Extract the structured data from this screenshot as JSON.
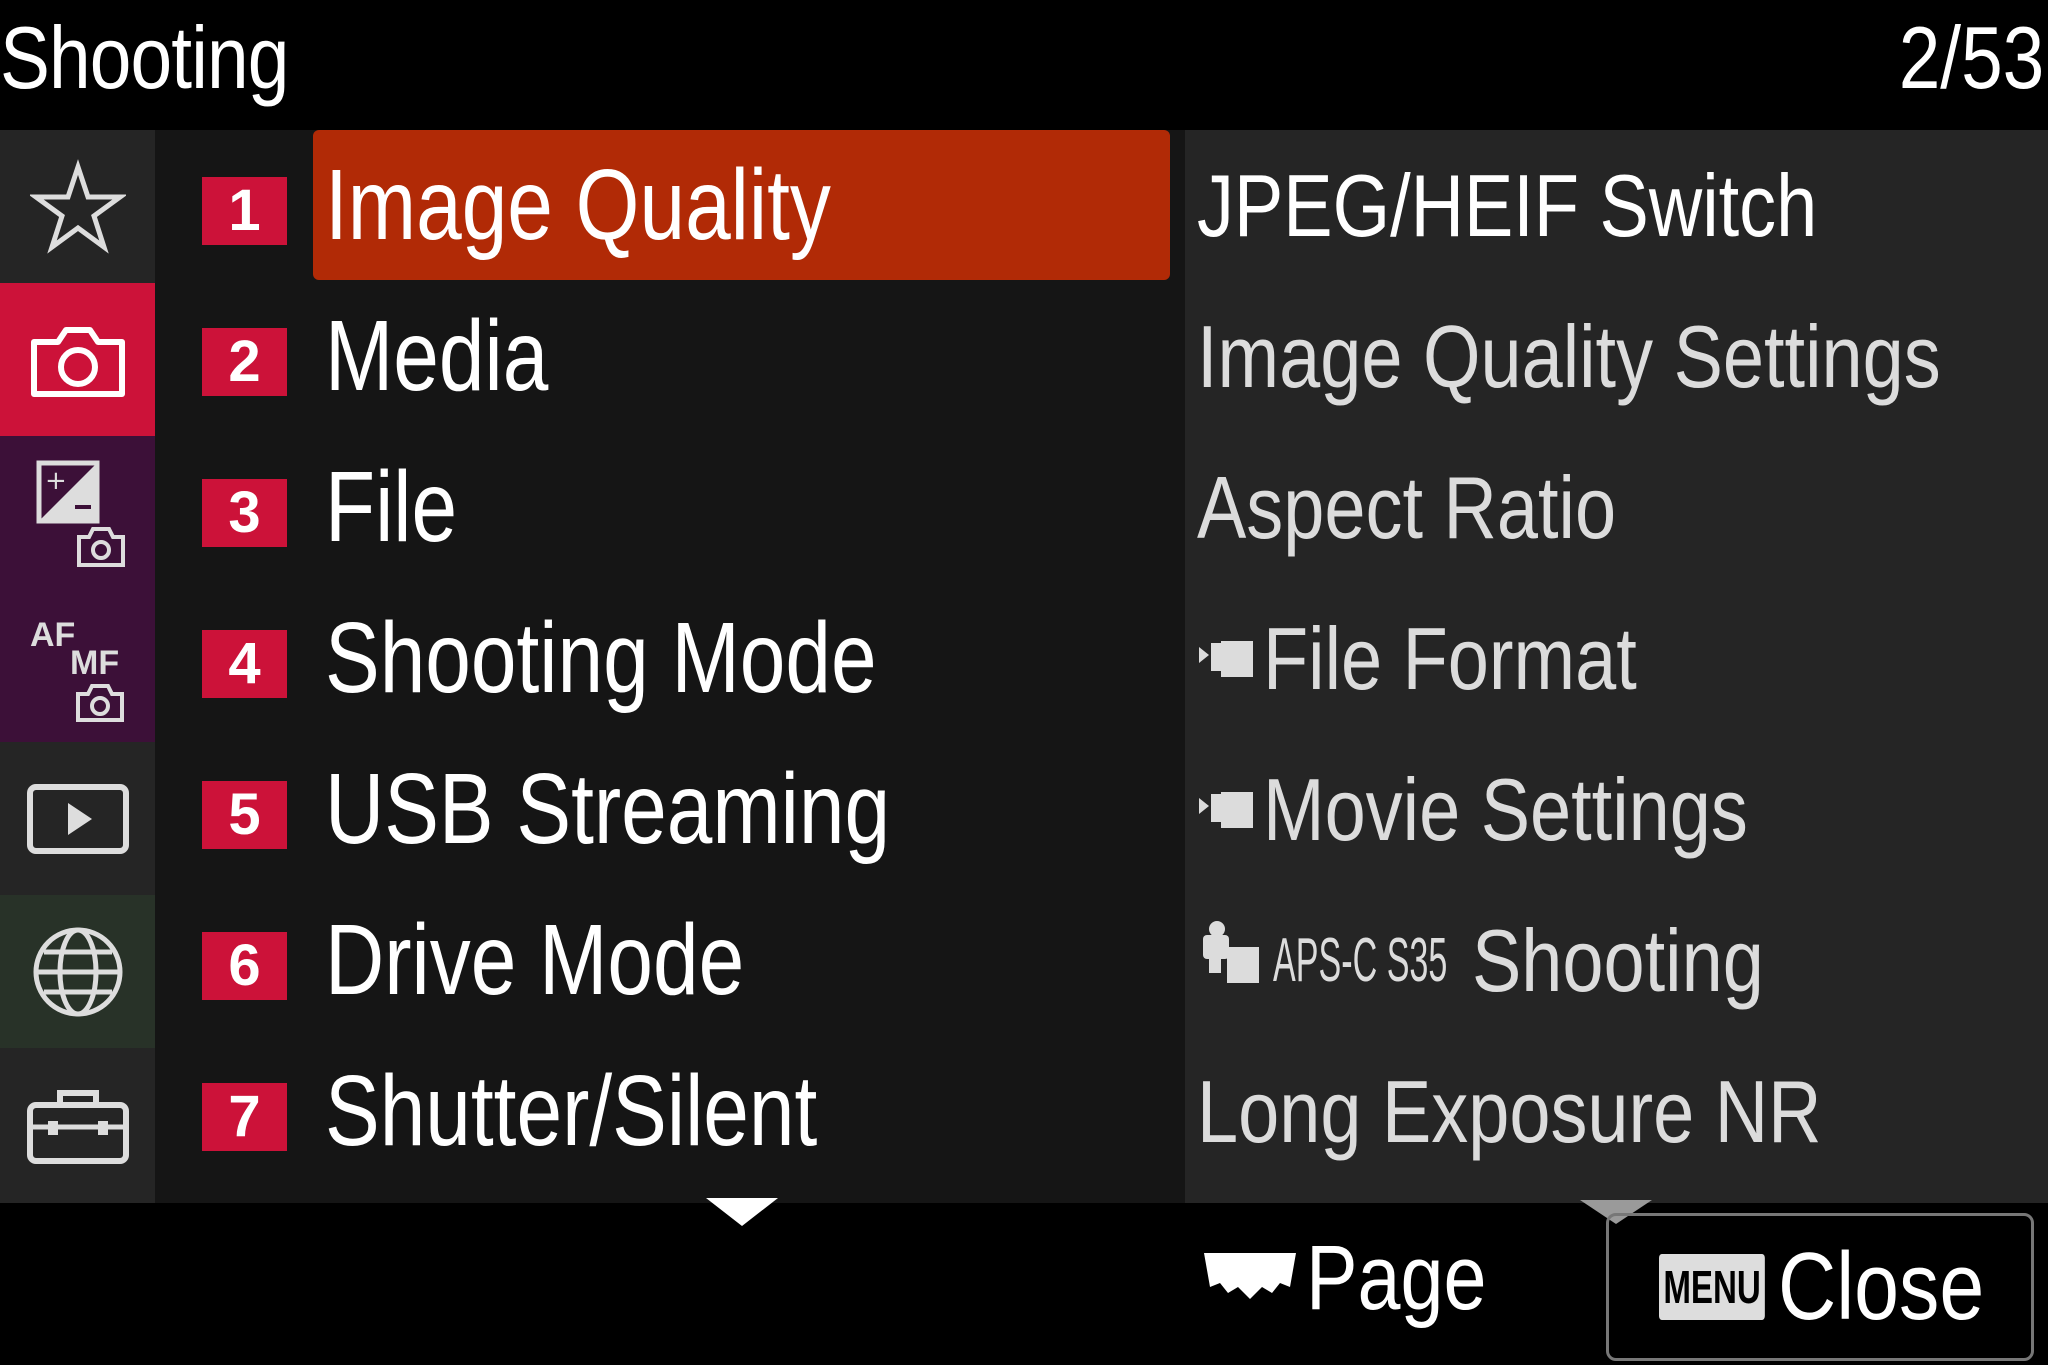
{
  "header": {
    "title": "Shooting",
    "page_indicator": "2/53"
  },
  "rail": {
    "tabs": [
      {
        "icon": "star-icon",
        "bg": "#252525"
      },
      {
        "icon": "camera-icon",
        "bg": "#cc1239"
      },
      {
        "icon": "exposure-camera-icon",
        "bg": "#3c1038"
      },
      {
        "icon": "af-mf-icon",
        "bg": "#3c1038",
        "af": "AF",
        "mf": "MF"
      },
      {
        "icon": "playback-icon",
        "bg": "#252525"
      },
      {
        "icon": "network-globe-icon",
        "bg": "#283228"
      },
      {
        "icon": "toolbox-icon",
        "bg": "#252525"
      }
    ]
  },
  "categories": [
    {
      "num": "1",
      "label": "Image Quality",
      "selected": true
    },
    {
      "num": "2",
      "label": "Media"
    },
    {
      "num": "3",
      "label": "File"
    },
    {
      "num": "4",
      "label": "Shooting Mode"
    },
    {
      "num": "5",
      "label": "USB Streaming"
    },
    {
      "num": "6",
      "label": "Drive Mode"
    },
    {
      "num": "7",
      "label": "Shutter/Silent"
    }
  ],
  "subitems": [
    {
      "label": "JPEG/HEIF Switch"
    },
    {
      "label": "Image Quality Settings"
    },
    {
      "label": "Aspect Ratio"
    },
    {
      "label": "File Format",
      "icon": "movie-icon"
    },
    {
      "label": "Movie Settings",
      "icon": "movie-icon"
    },
    {
      "label": "Shooting",
      "icon": "still-movie-icon",
      "prefix": "APS-C S35"
    },
    {
      "label": "Long Exposure NR"
    }
  ],
  "footer": {
    "page_label": "Page",
    "menu_key": "MENU",
    "close_label": "Close"
  }
}
